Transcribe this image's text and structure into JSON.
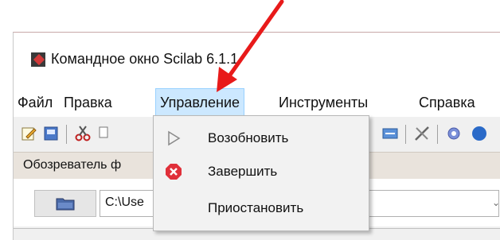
{
  "window": {
    "title": "Командное окно Scilab 6.1.1"
  },
  "menubar": {
    "items": [
      {
        "label": "Файл"
      },
      {
        "label": "Правка"
      },
      {
        "label": "Управление"
      },
      {
        "label": "Инструменты"
      },
      {
        "label": "Справка"
      }
    ]
  },
  "file_browser": {
    "title": "Обозреватель ф",
    "path_value": "C:\\Use"
  },
  "control_menu": {
    "items": [
      {
        "label": "Возобновить",
        "icon": "play-outline-icon",
        "enabled": false
      },
      {
        "label": "Завершить",
        "icon": "stop-icon",
        "color": "#e0303a"
      },
      {
        "label": "Приостановить",
        "icon": ""
      }
    ]
  },
  "annotation": {
    "arrow_color": "#e81a1a"
  }
}
